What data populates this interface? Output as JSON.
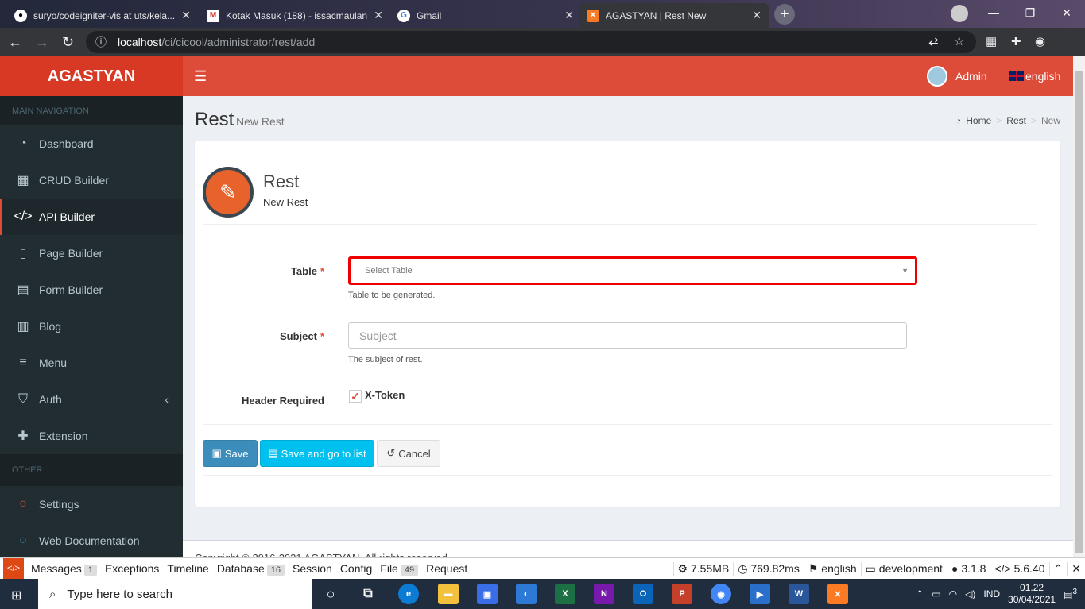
{
  "browser": {
    "tabs": [
      {
        "title": "suryo/codeigniter-vis at uts/kela...",
        "icon": "github-icon",
        "active": false
      },
      {
        "title": "Kotak Masuk (188) - issacmaulan",
        "icon": "gmail-icon",
        "active": false
      },
      {
        "title": "Gmail",
        "icon": "google-icon",
        "active": false
      },
      {
        "title": "AGASTYAN | Rest New",
        "icon": "xampp-icon",
        "active": true
      }
    ],
    "url_host": "localhost",
    "url_path": "/ci/cicool/administrator/rest/add"
  },
  "header": {
    "logo": "AGASTYAN",
    "user_name": "Admin",
    "language": "english"
  },
  "sidebar": {
    "main_heading": "MAIN NAVIGATION",
    "items": [
      {
        "label": "Dashboard",
        "icon": "dashboard-icon"
      },
      {
        "label": "CRUD Builder",
        "icon": "table-icon"
      },
      {
        "label": "API Builder",
        "icon": "code-icon",
        "active": true
      },
      {
        "label": "Page Builder",
        "icon": "file-icon"
      },
      {
        "label": "Form Builder",
        "icon": "form-icon"
      },
      {
        "label": "Blog",
        "icon": "document-icon"
      },
      {
        "label": "Menu",
        "icon": "bars-icon"
      },
      {
        "label": "Auth",
        "icon": "shield-icon"
      },
      {
        "label": "Extension",
        "icon": "puzzle-icon"
      }
    ],
    "other_heading": "OTHER",
    "other_items": [
      {
        "label": "Settings",
        "icon": "circle-red-icon",
        "color": "#dd4b39"
      },
      {
        "label": "Web Documentation",
        "icon": "circle-blue-icon",
        "color": "#3c8dbc"
      }
    ]
  },
  "page": {
    "title": "Rest",
    "subtitle": "New Rest",
    "breadcrumb": [
      "Home",
      "Rest",
      "New"
    ]
  },
  "form": {
    "widget_title": "Rest",
    "widget_subtitle": "New Rest",
    "table_label": "Table",
    "table_placeholder": "Select Table",
    "table_help": "Table to be generated.",
    "subject_label": "Subject",
    "subject_placeholder": "Subject",
    "subject_help": "The subject of rest.",
    "header_label": "Header Required",
    "header_option": "X-Token",
    "header_checked": true,
    "save_label": "Save",
    "save_list_label": "Save and go to list",
    "cancel_label": "Cancel"
  },
  "footer": {
    "text": "Copyright © 2016-2021 AGASTYAN. All rights reserved."
  },
  "debugbar": {
    "items": [
      {
        "label": "Messages",
        "badge": "1"
      },
      {
        "label": "Exceptions"
      },
      {
        "label": "Timeline"
      },
      {
        "label": "Database",
        "badge": "16"
      },
      {
        "label": "Session"
      },
      {
        "label": "Config"
      },
      {
        "label": "File",
        "badge": "49"
      },
      {
        "label": "Request"
      }
    ],
    "memory": "7.55MB",
    "time": "769.82ms",
    "locale": "english",
    "environment": "development",
    "ci_version": "3.1.8",
    "php_version": "5.6.40"
  },
  "taskbar": {
    "search_placeholder": "Type here to search",
    "language": "IND",
    "time": "01.22",
    "date": "30/04/2021",
    "notifications": "3"
  },
  "colors": {
    "header": "#dd4b39",
    "logo_bg": "#d73925",
    "sidebar": "#222d32",
    "primary": "#3c8dbc",
    "info": "#00c0ef",
    "error_border": "#ee0000"
  }
}
